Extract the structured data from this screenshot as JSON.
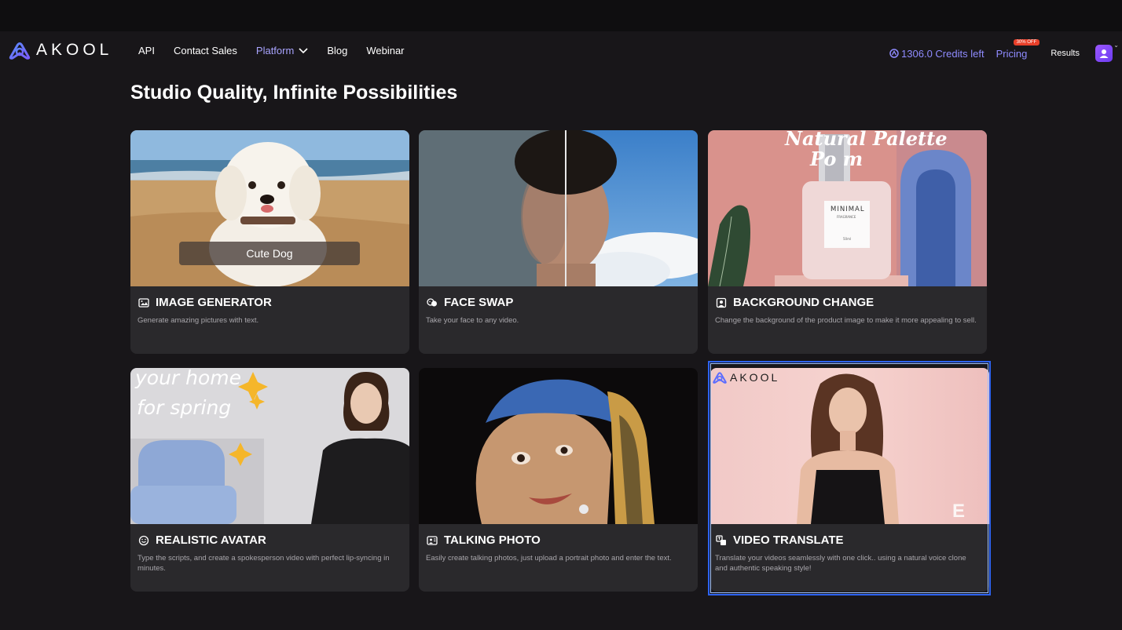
{
  "brand": {
    "name": "AKOOL"
  },
  "nav": {
    "links": [
      "API",
      "Contact Sales",
      "Platform",
      "Blog",
      "Webinar"
    ],
    "credits": "1306.0 Credits left",
    "pricing": "Pricing",
    "pricing_badge": "30% OFF",
    "results": "Results"
  },
  "section": {
    "title": "Studio Quality, Infinite Possibilities"
  },
  "cards": [
    {
      "title": "IMAGE GENERATOR",
      "desc": "Generate amazing pictures with text.",
      "image_label": "Cute Dog",
      "icon": "image-icon"
    },
    {
      "title": "FACE SWAP",
      "desc": "Take your face to any video.",
      "icon": "face-swap-icon"
    },
    {
      "title": "BACKGROUND CHANGE",
      "desc": "Change the background of the product image to make it more appealing to sell.",
      "icon": "background-icon",
      "image_text": [
        "Natural Palette",
        "Po      m",
        "MINIMAL",
        "FRAGRANCE",
        "50ml"
      ]
    },
    {
      "title": "REALISTIC AVATAR",
      "desc": "Type the scripts, and create a spokesperson video with perfect lip-syncing in minutes.",
      "icon": "avatar-icon",
      "image_text": [
        "your home",
        "for spring"
      ]
    },
    {
      "title": "TALKING PHOTO",
      "desc": "Easily create talking photos, just upload a portrait photo and enter the text.",
      "icon": "photo-icon"
    },
    {
      "title": "VIDEO TRANSLATE",
      "desc": "Translate your videos seamlessly with one click.. using a natural voice clone and authentic speaking style!",
      "icon": "translate-icon",
      "image_text": [
        "AKOOL",
        "E!"
      ]
    }
  ],
  "colors": {
    "background": "#181619",
    "card": "#2a292c",
    "accent": "#8f8bff",
    "badge": "#e8402a",
    "selected": "#2d63f0"
  }
}
